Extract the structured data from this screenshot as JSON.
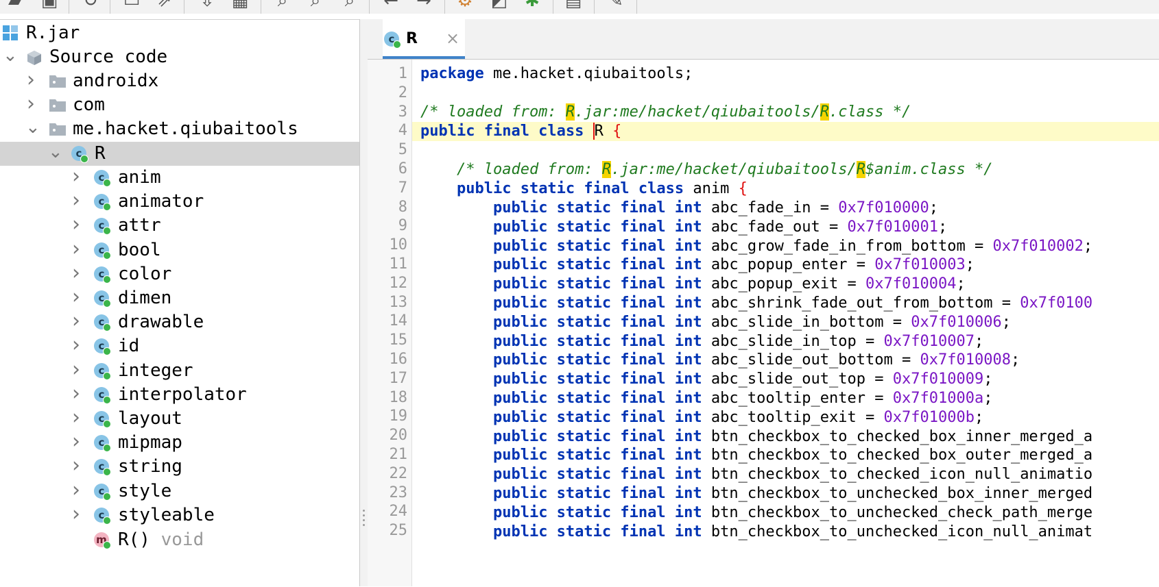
{
  "toolbar": {
    "icons": [
      "open-folder-icon",
      "add-file-icon",
      "refresh-icon",
      "save-icon",
      "export-icon",
      "download-icon",
      "grid-icon",
      "search-icon",
      "search-class-icon",
      "search-usage-icon",
      "back-icon",
      "forward-icon",
      "lock-settings-icon",
      "deobfuscate-icon",
      "debug-icon",
      "log-icon",
      "wrench-icon"
    ]
  },
  "tree": {
    "root": "R.jar",
    "source": "Source code",
    "packages": [
      "androidx",
      "com",
      "me.hacket.qiubaitools"
    ],
    "class_name": "R",
    "inner_classes": [
      "anim",
      "animator",
      "attr",
      "bool",
      "color",
      "dimen",
      "drawable",
      "id",
      "integer",
      "interpolator",
      "layout",
      "mipmap",
      "string",
      "style",
      "styleable"
    ],
    "method_name": "R()",
    "method_type": "void"
  },
  "editor": {
    "tab_title": "R",
    "tab_close": "×",
    "line_numbers": [
      "1",
      "2",
      "3",
      "4",
      "5",
      "6",
      "7",
      "8",
      "9",
      "10",
      "11",
      "12",
      "13",
      "14",
      "15",
      "16",
      "17",
      "18",
      "19",
      "20",
      "21",
      "22",
      "23",
      "24",
      "25"
    ],
    "lines": {
      "l1_kw": "package",
      "l1_rest": " me.hacket.qiubaitools;",
      "l3_a": "/* loaded from: ",
      "l3_r1": "R",
      "l3_b": ".jar:me/hacket/qiubaitools/",
      "l3_r2": "R",
      "l3_c": ".class */",
      "l4_kw": "public final class",
      "l4_name": "R",
      "l4_brace": "{",
      "l6_a": "/* loaded from: ",
      "l6_r1": "R",
      "l6_b": ".jar:me/hacket/qiubaitools/",
      "l6_r2": "R",
      "l6_c": "$anim.class */",
      "l7_kw": "public static final class",
      "l7_name": " anim ",
      "l7_brace": "{",
      "field_kw": "public static final int",
      "fields": [
        {
          "name": " abc_fade_in = ",
          "value": "0x7f010000",
          "end": ";"
        },
        {
          "name": " abc_fade_out = ",
          "value": "0x7f010001",
          "end": ";"
        },
        {
          "name": " abc_grow_fade_in_from_bottom = ",
          "value": "0x7f010002",
          "end": ";"
        },
        {
          "name": " abc_popup_enter = ",
          "value": "0x7f010003",
          "end": ";"
        },
        {
          "name": " abc_popup_exit = ",
          "value": "0x7f010004",
          "end": ";"
        },
        {
          "name": " abc_shrink_fade_out_from_bottom = ",
          "value": "0x7f0100",
          "end": ""
        },
        {
          "name": " abc_slide_in_bottom = ",
          "value": "0x7f010006",
          "end": ";"
        },
        {
          "name": " abc_slide_in_top = ",
          "value": "0x7f010007",
          "end": ";"
        },
        {
          "name": " abc_slide_out_bottom = ",
          "value": "0x7f010008",
          "end": ";"
        },
        {
          "name": " abc_slide_out_top = ",
          "value": "0x7f010009",
          "end": ";"
        },
        {
          "name": " abc_tooltip_enter = ",
          "value": "0x7f01000a",
          "end": ";"
        },
        {
          "name": " abc_tooltip_exit = ",
          "value": "0x7f01000b",
          "end": ";"
        },
        {
          "name": " btn_checkbox_to_checked_box_inner_merged_a",
          "value": "",
          "end": ""
        },
        {
          "name": " btn_checkbox_to_checked_box_outer_merged_a",
          "value": "",
          "end": ""
        },
        {
          "name": " btn_checkbox_to_checked_icon_null_animatio",
          "value": "",
          "end": ""
        },
        {
          "name": " btn_checkbox_to_unchecked_box_inner_merged",
          "value": "",
          "end": ""
        },
        {
          "name": " btn_checkbox_to_unchecked_check_path_merge",
          "value": "",
          "end": ""
        },
        {
          "name": " btn_checkbox_to_unchecked_icon_null_animat",
          "value": "",
          "end": ""
        }
      ]
    }
  }
}
